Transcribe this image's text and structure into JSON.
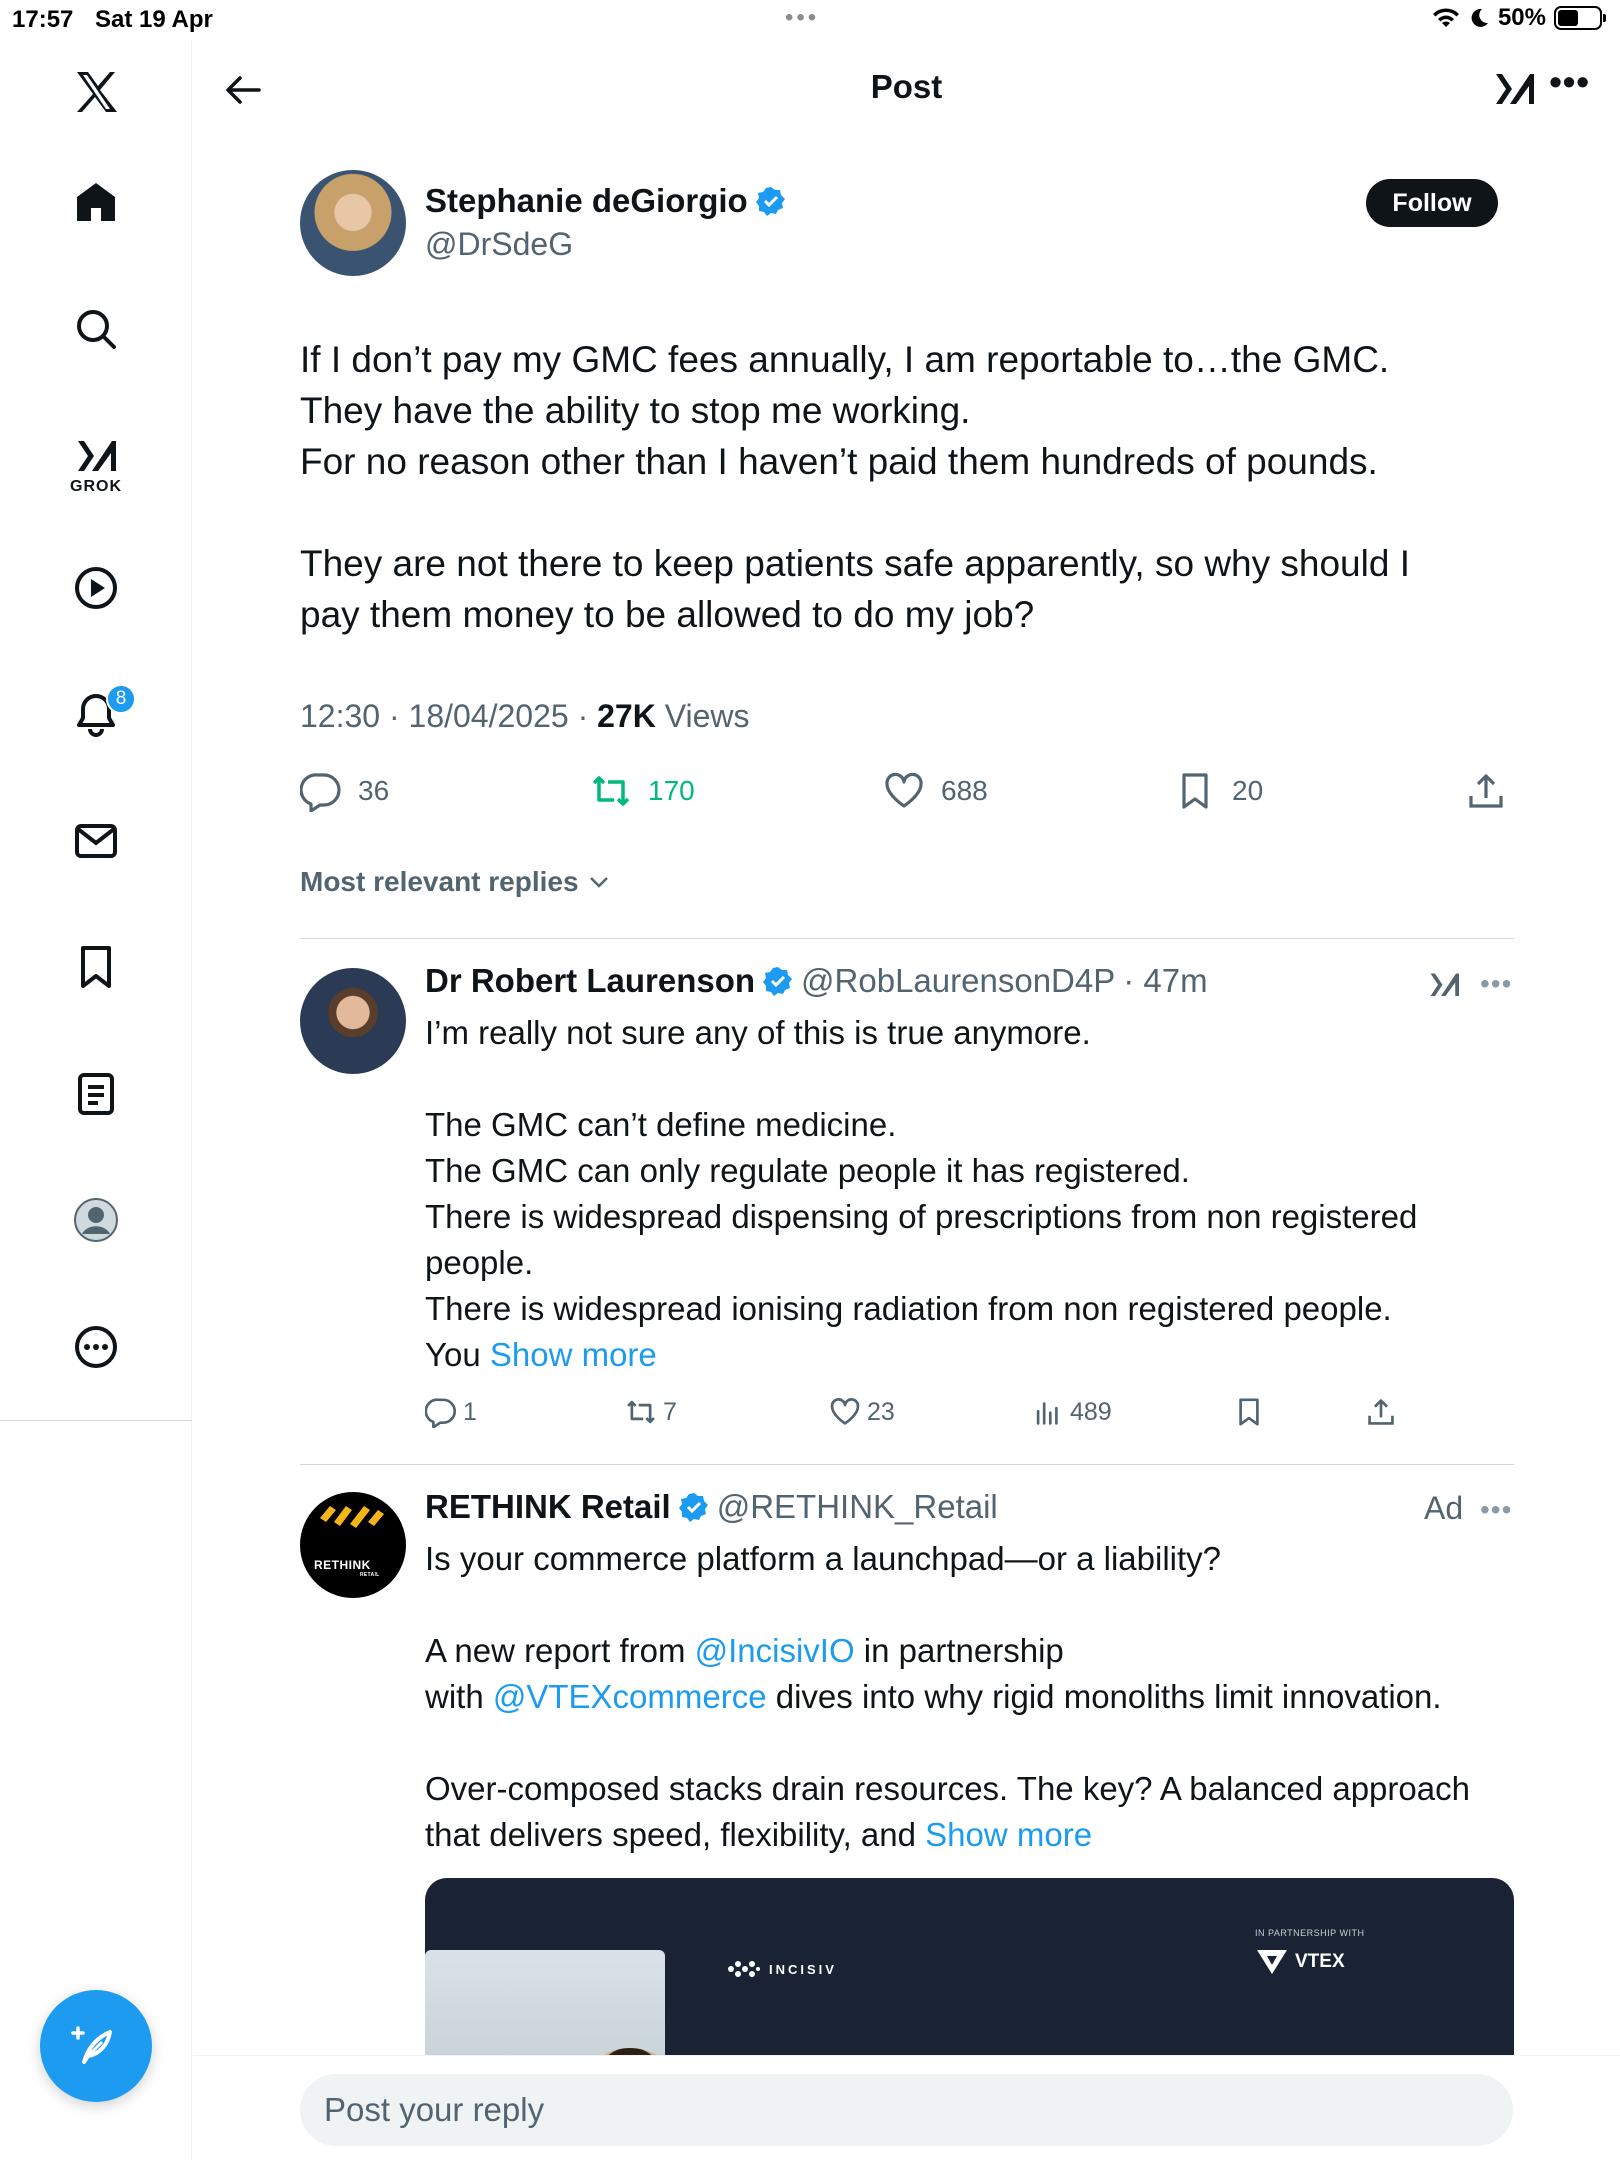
{
  "status_bar": {
    "time": "17:57",
    "date": "Sat 19 Apr",
    "dots": "•••",
    "battery": "50%"
  },
  "sidebar": {
    "items": [
      {
        "icon": "x-logo-icon"
      },
      {
        "icon": "home-icon"
      },
      {
        "icon": "search-icon"
      },
      {
        "icon": "grok-icon",
        "label": "GROK"
      },
      {
        "icon": "video-icon"
      },
      {
        "icon": "notifications-icon",
        "badge": "8"
      },
      {
        "icon": "messages-icon"
      },
      {
        "icon": "bookmarks-icon"
      },
      {
        "icon": "lists-icon"
      },
      {
        "icon": "profile-icon"
      },
      {
        "icon": "more-icon"
      }
    ],
    "compose_icon": "compose-feather-icon"
  },
  "header": {
    "title": "Post",
    "more": "•••"
  },
  "post": {
    "author_name": "Stephanie deGiorgio",
    "author_handle": "@DrSdeG",
    "follow_label": "Follow",
    "lines": [
      "If I don’t pay my GMC fees annually, I am reportable to…the GMC.",
      "They have the ability to stop me working.",
      "For no reason other than I haven’t paid them hundreds of pounds.",
      "",
      "They are not there to keep patients safe apparently, so why should I",
      "pay them money to be allowed to do my job?"
    ],
    "meta_time": "12:30 · 18/04/2025 · ",
    "meta_views_count": "27K",
    "meta_views_label": " Views",
    "stats": {
      "replies": "36",
      "reposts": "170",
      "likes": "688",
      "bookmarks": "20"
    },
    "colors": {
      "repost": "#00ba7c",
      "link": "#1d9bf0"
    }
  },
  "replies_sort": "Most relevant replies",
  "reply1": {
    "name": "Dr Robert Laurenson",
    "handle": "@RobLaurensonD4P",
    "time": "· 47m",
    "lines": [
      "I’m really not sure any of this is true anymore.",
      "",
      "The GMC can’t define medicine.",
      "The GMC can only regulate people it has registered.",
      "There is widespread dispensing of prescriptions from non registered",
      "people.",
      "There is widespread ionising radiation from non registered people."
    ],
    "last_line_prefix": "You ",
    "show_more": "Show more",
    "more": "•••",
    "stats": {
      "replies": "1",
      "reposts": "7",
      "likes": "23",
      "views": "489"
    }
  },
  "reply2": {
    "name": "RETHINK Retail",
    "handle": "@RETHINK_Retail",
    "ad_label": "Ad",
    "more": "•••",
    "avatar_text": "RETHINK",
    "avatar_subtext": "RETAIL",
    "line1": "Is your commerce platform a launchpad—or a liability?",
    "line3_prefix": "A new report from ",
    "mention1": "@IncisivIO",
    "line3_suffix": " in partnership",
    "line4_prefix": "with ",
    "mention2": "@VTEXcommerce",
    "line4_suffix": " dives into why rigid monoliths limit innovation.",
    "line6": "Over-composed stacks drain resources. The key? A balanced approach",
    "line7_prefix": "that delivers speed, flexibility, and ",
    "show_more": "Show more",
    "media": {
      "brand1": "INCISIV",
      "partner_label": "IN PARTNERSHIP WITH",
      "brand2": "VTEX"
    }
  },
  "reply_bar": {
    "placeholder": "Post your reply"
  }
}
